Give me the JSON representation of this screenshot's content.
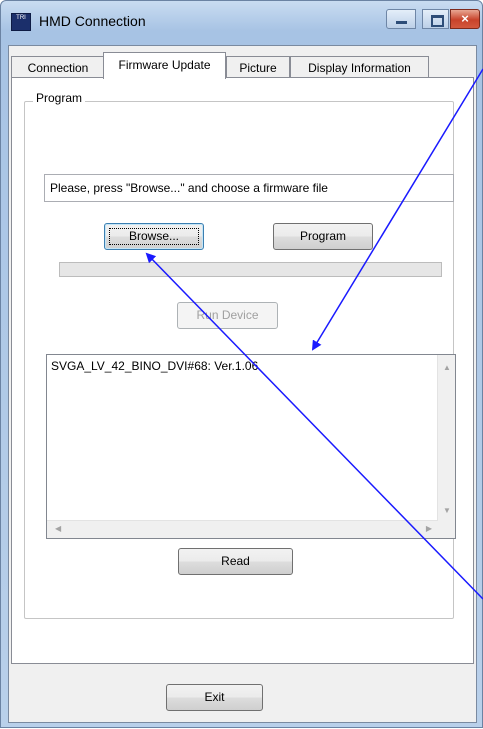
{
  "window": {
    "title": "HMD Connection",
    "icon_text": "TRI",
    "controls": {
      "minimize": "minimize-icon",
      "maximize": "maximize-icon",
      "close": "×"
    }
  },
  "tabs": [
    {
      "label": "Connection",
      "active": false
    },
    {
      "label": "Firmware Update",
      "active": true
    },
    {
      "label": "Picture",
      "active": false
    },
    {
      "label": "Display Information",
      "active": false
    }
  ],
  "program_group": {
    "label": "Program",
    "status_text": "Please, press \"Browse...\" and choose a firmware file",
    "browse_label": "Browse...",
    "program_label": "Program",
    "progress": 0,
    "run_device_label": "Run Device"
  },
  "device_list": {
    "items": [
      "SVGA_LV_42_BINO_DVI#68: Ver.1.06"
    ]
  },
  "read_label": "Read",
  "exit_label": "Exit",
  "colors": {
    "annotation_arrow": "#1a1aff",
    "progress_fill": "#06b025",
    "close_button": "#c8432b"
  }
}
